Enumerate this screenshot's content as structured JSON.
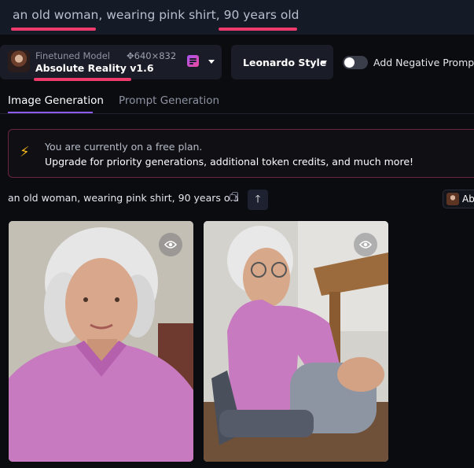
{
  "prompt_bar": {
    "text": "an old woman, wearing pink shirt,  90 years old",
    "highlight_color": "#ee3b6c"
  },
  "model": {
    "label": "Finetuned Model",
    "dimensions": "640×832",
    "dimensions_icon": "move-arrows-icon",
    "name": "Absolute Reality v1.6"
  },
  "style_dropdown": {
    "value": "Leonardo Style"
  },
  "negative_prompt": {
    "label": "Add Negative Prompt",
    "enabled": false
  },
  "tabs": [
    {
      "label": "Image Generation",
      "active": true
    },
    {
      "label": "Prompt Generation",
      "active": false
    }
  ],
  "banner": {
    "icon": "lightning-icon",
    "line1": "You are currently on a free plan.",
    "line2": "Upgrade for priority generations, additional token credits, and much more!"
  },
  "generation": {
    "prompt": "an old woman, wearing pink shirt, 90 years old",
    "model_chip": "Ab"
  },
  "images": [
    {
      "alt_icon": "eye-icon"
    },
    {
      "alt_icon": "eye-icon"
    }
  ],
  "colors": {
    "accent": "#8b5cf6",
    "background": "#0b0c10",
    "panel": "#1a1c27",
    "banner_border": "#6b2542",
    "bolt": "#f5b71c"
  }
}
